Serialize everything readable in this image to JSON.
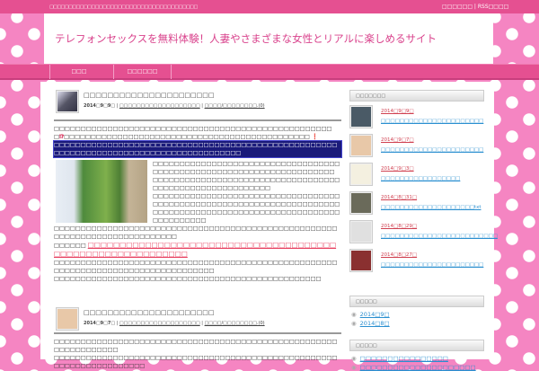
{
  "topbar": {
    "tagline": "□□□□□□□□□□□□□□□□□□□□□□□□□□□□□□□□□□□□□□□",
    "links": "□□□□□□ | RSS□□□□"
  },
  "header": {
    "title": "テレフォンセックスを無料体験！人妻やさまざまな女性とリアルに楽しめるサイト"
  },
  "nav": [
    "□□□",
    "□□□□□□"
  ],
  "posts": [
    {
      "title": "□□□□□□□□□□□□□□□□□□□□□□",
      "date": "2014□9□9□",
      "category": "□□□□□□□□□□□□□□□□□□□",
      "comments": "□□□□/□□□□□□□□.(0)",
      "lines": [
        "□□□□□□□□□□□□□□□□□□□□□□□□□□□□□□□□□□□□□□□□□□□□□□□□□□□□□",
        "⁉",
        "□□□□□□□□□□□□□□□□□□□□□□□□□□□□□□□□□□□□□",
        "□□□□□□□□□",
        "❗"
      ],
      "highlight": "□□□□□□□□□□□□□□□□□□□□□□□□□□□□□□□□□□□□□□□□□□□□□□□□□□□□□□□□□□□□□□□□□□□□□□□□□□□□□□□□□□□□□□□□",
      "beside": [
        "□□□□□□□□□□□□□□□□□□□□□□□□□□□□□□□□□□□□□□□□□□□□□□□□□□□□□□□□□□□□□□□□□□□□□",
        "□□□□□□□□□□□□□□□□□□□□□□□□□□□□□□□□□□□□□□□□□□□□□□□□□□□□□□□□□",
        "□□□□□□□□□□□□□□□□□□□□□□□□□□□□□□□□□□□□□□□□□□□□□□□□□□□□□□□□□□□□□□□□□□□□□□□□□□□□□□□□□□□□□□□□□□□□□□□□□□□□□□□□□□□□□□□□□□□",
        "□□□□□□□□□□□□□□□□□□□□□□□□□□□□□□□□□□□□□□□□□□□□□□□□□□□□□□□□□□□□□□□□□□□□□□□□□□□□"
      ],
      "link_label": "□□□□□□",
      "link": "□□□□□□□□□□□□□□□□□□□□□□□□□□□□□□□□□□□□□□□□□□□□□□□□□□□□□□□□□□□□",
      "after": [
        "□□□□□□□□□□□□□□□□□□□□□□□□□□□□□□□□□□□□□□□□□□□□□□□□□□□□□□□□□□□□□□□□□□□□□□□□□□□□□□□□□□□",
        "□□□□□□□□□□□□□□□□□□□□□□□□□□□□□□□□□□□□□□□□□□□□□□□□□□"
      ]
    },
    {
      "title": "□□□□□□□□□□□□□□□□□□□□□□",
      "date": "2014□9□7□",
      "category": "□□□□□□□□□□□□□□□□□□□",
      "comments": "□□□□/□□□□□□□□.(0)",
      "lines": [
        "□□□□□□□□□□□□□□□□□□□□□□□□□□□□□□□□□□□□□□□□□□□□□□□□□□□□□□□□□□□□□□□□□",
        "□□□□□□□□□□□□□□□□□□□□□□□□□□□□□□□□□□□□□□□□□□□□□□□□□□□□□□□□□□□□□□□□□□□□□□"
      ]
    }
  ],
  "sidebar": {
    "recent_heading": "□□□□□□□",
    "recent": [
      {
        "date": "2014□9□9□",
        "title": "□□□□□□□□□□□□□□□□□□□□□□",
        "color": "#4a5a66"
      },
      {
        "date": "2014□9□7□",
        "title": "□□□□□□□□□□□□□□□□□□□□□□",
        "color": "#e8c8a8"
      },
      {
        "date": "2014□9□3□",
        "title": "□□□□□□□□□□□□□□□□□",
        "color": "#f4f0e0"
      },
      {
        "date": "2014□8□31□",
        "title": "□□□□□□□□□□□□□□□□□□□□txt",
        "color": "#6a6a5a"
      },
      {
        "date": "2014□8□29□",
        "title": "□□□□□□□□□□□□□□□□□□□□□□□□□",
        "color": "#e0e0e0"
      },
      {
        "date": "2014□8□27□",
        "title": "□□□□□□□□□□□□□□□□□□□□□□",
        "color": "#8a3030"
      }
    ],
    "archive_heading": "□□□□□",
    "archives": [
      "2014□9□",
      "2014□8□"
    ],
    "category_heading": "□□□□□",
    "categories": [
      "□□□□□□□□□□□□□□□□",
      "□□□□□□□□□□□□□□□□□□□□□"
    ]
  }
}
